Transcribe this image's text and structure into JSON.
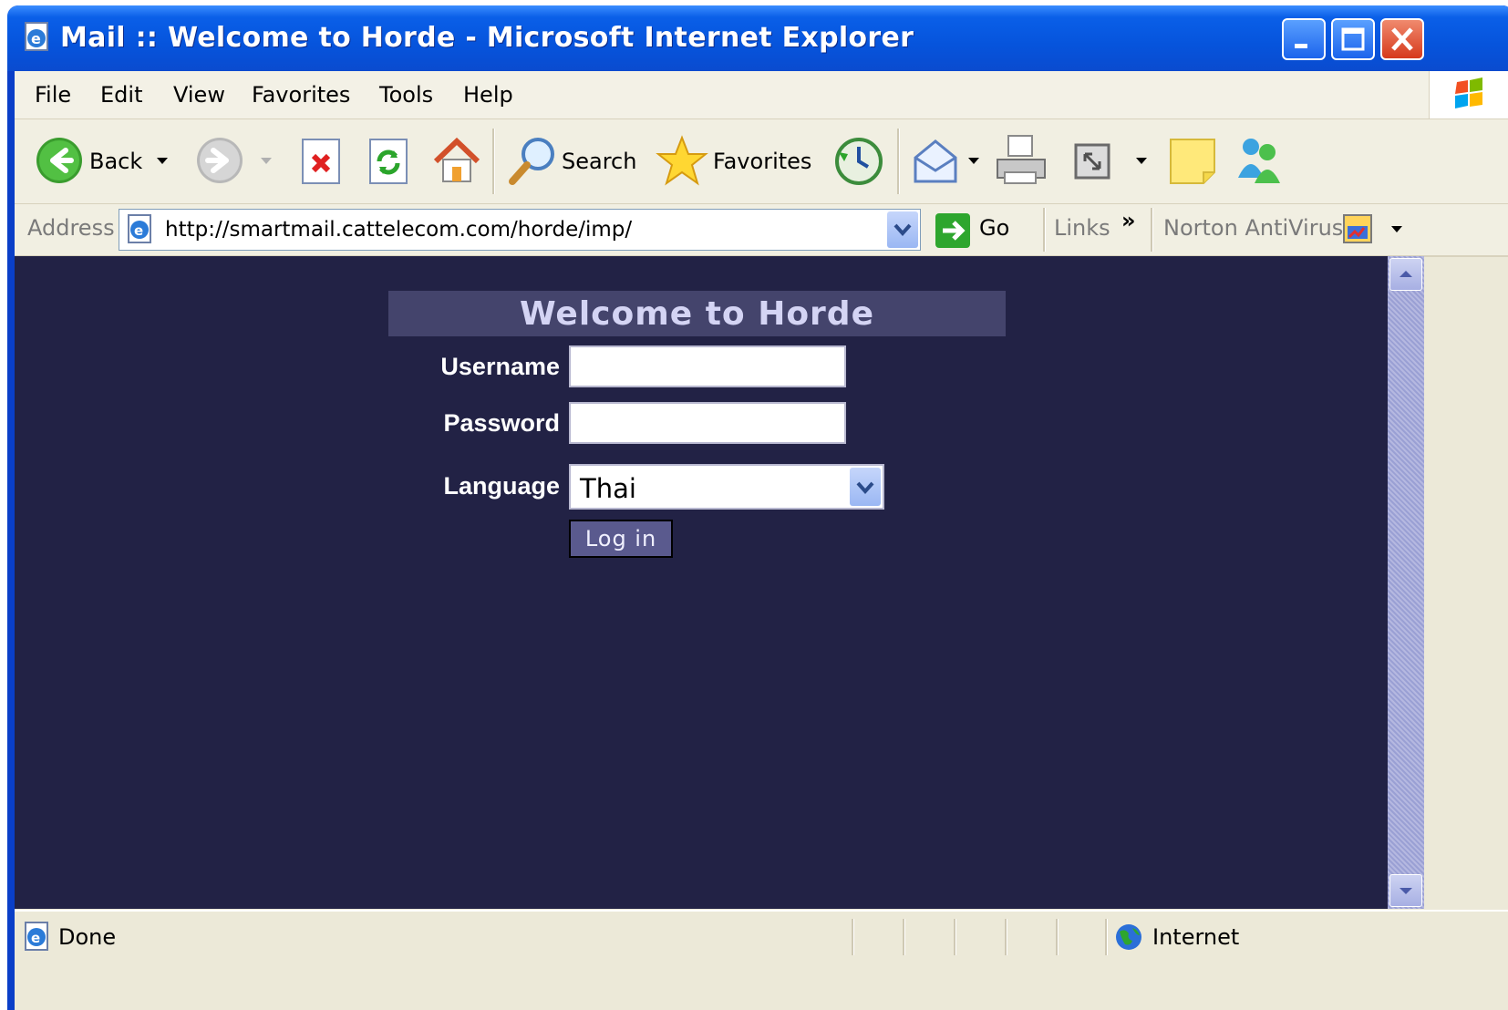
{
  "window": {
    "title": "Mail :: Welcome to Horde - Microsoft Internet Explorer"
  },
  "menu": [
    "File",
    "Edit",
    "View",
    "Favorites",
    "Tools",
    "Help"
  ],
  "toolbar": {
    "back_label": "Back",
    "search_label": "Search",
    "favorites_label": "Favorites"
  },
  "address": {
    "label": "Address",
    "url": "http://smartmail.cattelecom.com/horde/imp/",
    "go_label": "Go",
    "links_label": "Links",
    "links_chevron": "»",
    "norton_label": "Norton AntiVirus"
  },
  "login": {
    "heading": "Welcome to Horde",
    "username_label": "Username",
    "username_value": "",
    "password_label": "Password",
    "password_value": "",
    "language_label": "Language",
    "language_selected": "Thai",
    "submit_label": "Log in"
  },
  "status": {
    "text": "Done",
    "zone": "Internet"
  },
  "colors": {
    "page_background": "#222245",
    "heading_background": "#44446c",
    "heading_text": "#d4d4f4",
    "button_background": "#5a5a8e"
  }
}
